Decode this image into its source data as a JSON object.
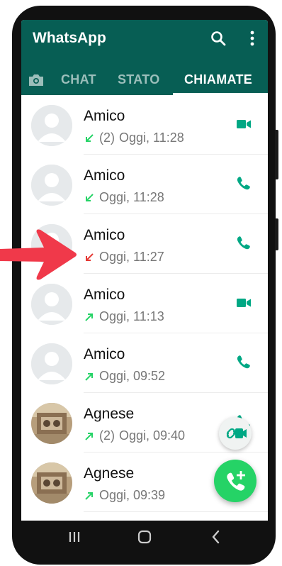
{
  "app": {
    "title": "WhatsApp"
  },
  "header": {
    "search_icon": "search-icon",
    "more_icon": "more-vert-icon"
  },
  "tabs": [
    {
      "label": "CHAT",
      "active": false
    },
    {
      "label": "STATO",
      "active": false
    },
    {
      "label": "CHIAMATE",
      "active": true
    }
  ],
  "calls": [
    {
      "name": "Amico",
      "direction": "incoming",
      "count": "(2)",
      "time": "Oggi, 11:28",
      "type": "video",
      "avatar": "default"
    },
    {
      "name": "Amico",
      "direction": "incoming",
      "count": "",
      "time": "Oggi, 11:28",
      "type": "voice",
      "avatar": "default"
    },
    {
      "name": "Amico",
      "direction": "missed",
      "count": "",
      "time": "Oggi, 11:27",
      "type": "voice",
      "avatar": "default"
    },
    {
      "name": "Amico",
      "direction": "outgoing",
      "count": "",
      "time": "Oggi, 11:13",
      "type": "video",
      "avatar": "default"
    },
    {
      "name": "Amico",
      "direction": "outgoing",
      "count": "",
      "time": "Oggi, 09:52",
      "type": "voice",
      "avatar": "default"
    },
    {
      "name": "Agnese",
      "direction": "outgoing",
      "count": "(2)",
      "time": "Oggi, 09:40",
      "type": "voice",
      "avatar": "photo"
    },
    {
      "name": "Agnese",
      "direction": "outgoing",
      "count": "",
      "time": "Oggi, 09:39",
      "type": "voice",
      "avatar": "photo"
    }
  ],
  "colors": {
    "header": "#075e54",
    "accent": "#00a884",
    "incoming": "#25d366",
    "missed": "#e53935",
    "fab": "#25d366",
    "annotation": "#f0394a"
  }
}
